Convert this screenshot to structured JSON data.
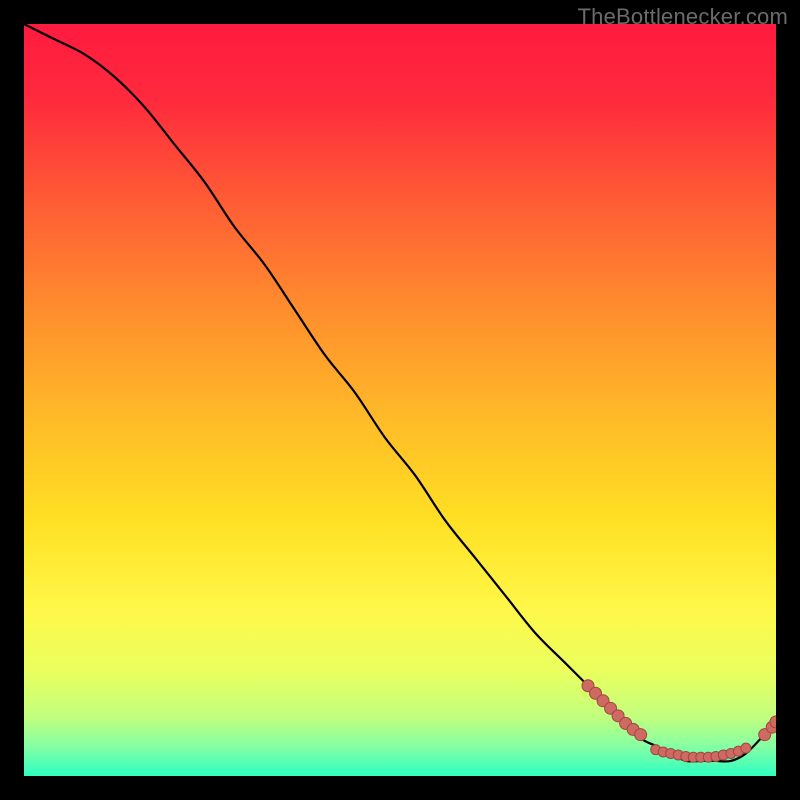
{
  "watermark": "TheBottlenecker.com",
  "palette": {
    "gradient_stops": [
      {
        "offset": 0.0,
        "color": "#ff1a3f"
      },
      {
        "offset": 0.1,
        "color": "#ff2a3d"
      },
      {
        "offset": 0.23,
        "color": "#ff5a35"
      },
      {
        "offset": 0.37,
        "color": "#ff8a2e"
      },
      {
        "offset": 0.52,
        "color": "#ffb928"
      },
      {
        "offset": 0.66,
        "color": "#ffe023"
      },
      {
        "offset": 0.78,
        "color": "#fff84a"
      },
      {
        "offset": 0.86,
        "color": "#eaff5e"
      },
      {
        "offset": 0.92,
        "color": "#c3ff7d"
      },
      {
        "offset": 0.96,
        "color": "#86ffa2"
      },
      {
        "offset": 1.0,
        "color": "#2effc0"
      }
    ],
    "curve_stroke": "#000000",
    "marker_fill": "#cf6a63",
    "marker_stroke": "#a04742"
  },
  "chart_data": {
    "type": "line",
    "title": "",
    "xlabel": "",
    "ylabel": "",
    "xlim": [
      0,
      100
    ],
    "ylim": [
      0,
      100
    ],
    "series": [
      {
        "name": "bottleneck-curve",
        "x": [
          0,
          4,
          8,
          12,
          16,
          20,
          24,
          28,
          32,
          36,
          40,
          44,
          48,
          52,
          56,
          60,
          64,
          68,
          72,
          76,
          78,
          80,
          82,
          84,
          86,
          88,
          90,
          92,
          94,
          96,
          98,
          100
        ],
        "y": [
          100,
          98,
          96,
          93,
          89,
          84,
          79,
          73,
          68,
          62,
          56,
          51,
          45,
          40,
          34,
          29,
          24,
          19,
          15,
          11,
          9,
          7,
          5,
          4,
          3,
          2,
          2,
          2,
          2,
          3,
          5,
          7
        ]
      }
    ],
    "markers": [
      {
        "name": "left-cluster",
        "x": [
          75,
          76,
          77,
          78,
          79,
          80,
          81,
          82
        ],
        "y": [
          12,
          11,
          10,
          9,
          8,
          7,
          6.2,
          5.5
        ],
        "size": 6
      },
      {
        "name": "floor-cluster",
        "x": [
          84,
          85,
          86,
          87,
          88,
          89,
          90,
          91,
          92,
          93,
          94,
          95,
          96
        ],
        "y": [
          3.5,
          3.2,
          3.0,
          2.8,
          2.6,
          2.5,
          2.5,
          2.5,
          2.6,
          2.8,
          3.0,
          3.3,
          3.7
        ],
        "size": 5
      },
      {
        "name": "right-cluster",
        "x": [
          98.5,
          99.5,
          100
        ],
        "y": [
          5.5,
          6.5,
          7.2
        ],
        "size": 6
      }
    ]
  }
}
